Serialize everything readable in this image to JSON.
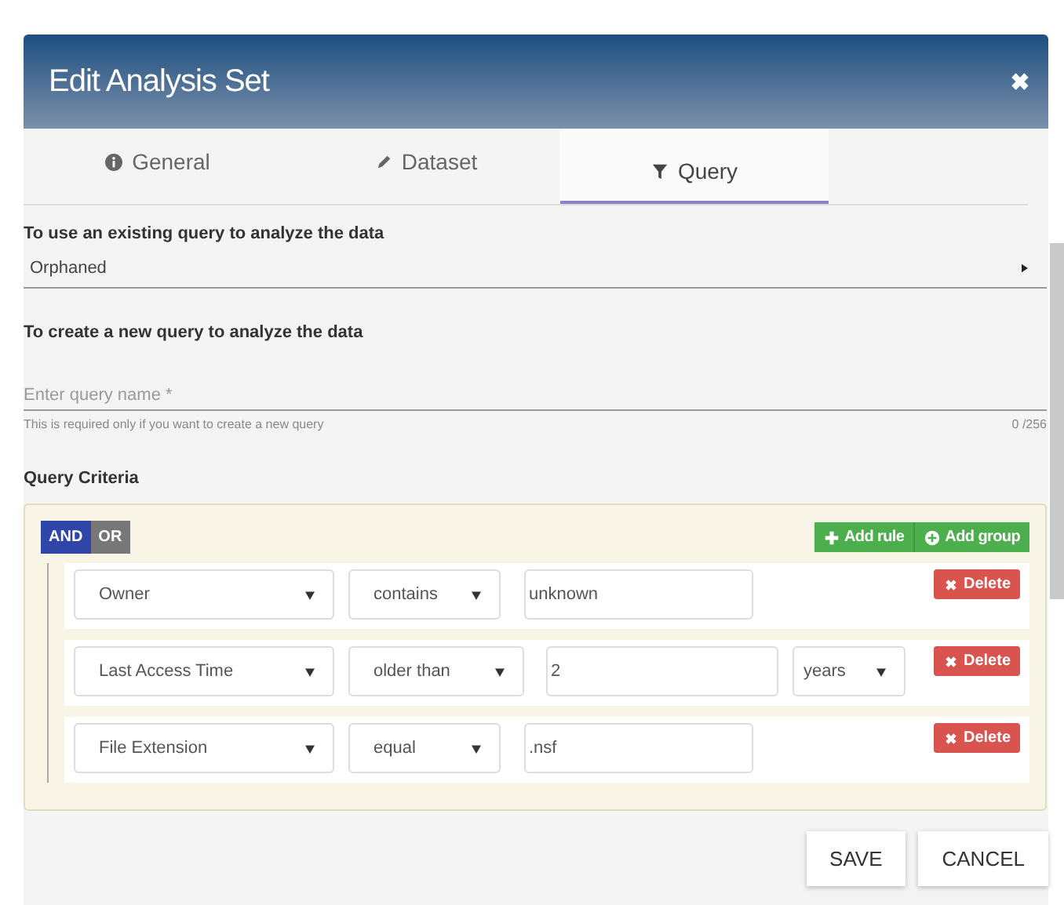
{
  "window": {
    "title": "Edit Analysis Set"
  },
  "tabs": [
    {
      "label": "General",
      "selected": false
    },
    {
      "label": "Dataset",
      "selected": false
    },
    {
      "label": "Query",
      "selected": true
    }
  ],
  "existing_query": {
    "heading": "To use an existing query to analyze the data",
    "value": "Orphaned"
  },
  "new_query": {
    "heading": "To create a new query to analyze the data",
    "placeholder": "Enter query name *",
    "hint": "This is required only if you want to create a new query",
    "counter": "0 /256"
  },
  "criteria": {
    "heading": "Query Criteria",
    "conditions": [
      {
        "label": "AND",
        "selected": true
      },
      {
        "label": "OR",
        "selected": false
      }
    ],
    "actions": [
      {
        "label": "Add rule"
      },
      {
        "label": "Add group"
      }
    ],
    "rules": [
      {
        "field": "Owner",
        "operator": "contains",
        "value": "unknown",
        "delete": "Delete"
      },
      {
        "field": "Last Access Time",
        "operator": "older than",
        "value": "2",
        "unit": "years",
        "delete": "Delete"
      },
      {
        "field": "File Extension",
        "operator": "equal",
        "value": ".nsf",
        "delete": "Delete"
      }
    ]
  },
  "buttons": [
    "SAVE",
    "CANCEL"
  ]
}
